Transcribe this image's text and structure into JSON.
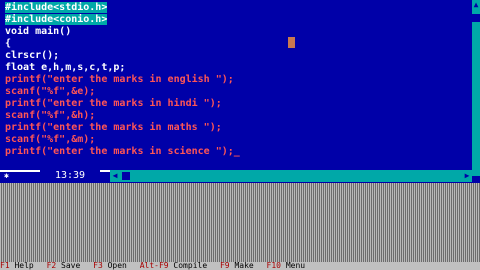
{
  "editor": {
    "lines": [
      "#include<stdio.h>",
      "#include<conio.h>",
      "void main()",
      "{",
      "clrscr();",
      "float e,h,m,s,c,t,p;",
      "printf(\"enter the marks in english \");",
      "scanf(\"%f\",&e);",
      "printf(\"enter the marks in hindi \");",
      "scanf(\"%f\",&h);",
      "printf(\"enter the marks in maths \");",
      "scanf(\"%f\",&m);",
      "printf(\"enter the marks in science \");_"
    ],
    "position": "13:39"
  },
  "status_bar": {
    "items": [
      {
        "key": "F1",
        "label": "Help"
      },
      {
        "key": "F2",
        "label": "Save"
      },
      {
        "key": "F3",
        "label": "Open"
      },
      {
        "key": "Alt-F9",
        "label": "Compile"
      },
      {
        "key": "F9",
        "label": "Make"
      },
      {
        "key": "F10",
        "label": "Menu"
      }
    ]
  },
  "colors": {
    "editor_bg": "#0000a8",
    "highlight": "#00a8a8",
    "string_text": "#ff5555",
    "code_text": "#ffffff"
  }
}
